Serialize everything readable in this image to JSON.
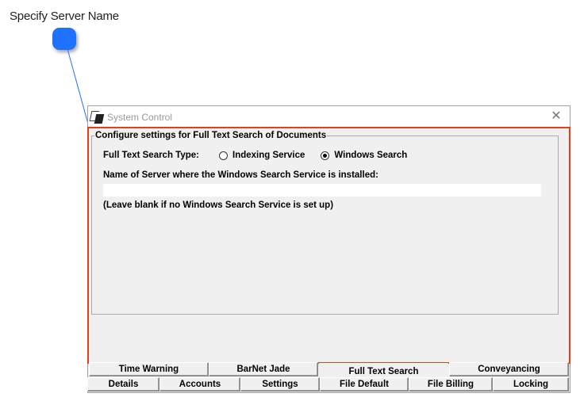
{
  "callout": {
    "title": "Specify Server Name",
    "dot_color": "#1e72ff"
  },
  "window": {
    "title": "System Control",
    "close_glyph": "✕",
    "group_title": "Configure settings for Full Text Search of Documents",
    "type_label": "Full Text Search Type:",
    "options": [
      {
        "label": "Indexing Service",
        "checked": false
      },
      {
        "label": "Windows Search",
        "checked": true
      }
    ],
    "server_label": "Name of Server where the Windows Search Service is installed:",
    "server_value": "",
    "note": "(Leave blank if no Windows Search Service is set up)"
  },
  "tabs_top": [
    "Time Warning",
    "BarNet Jade",
    "Full Text Search",
    "Conveyancing"
  ],
  "tabs_bottom": [
    "Details",
    "Accounts",
    "Settings",
    "File Default",
    "File Billing",
    "Locking"
  ],
  "active_tab": "Full Text Search",
  "highlight_color": "#e0401c",
  "icons": {
    "app": "app-logo-icon",
    "close": "close-icon"
  }
}
